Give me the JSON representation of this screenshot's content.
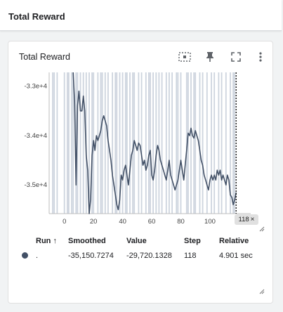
{
  "section": {
    "title": "Total Reward"
  },
  "card": {
    "title": "Total Reward",
    "toolbar": {
      "icons": [
        "fit-domain-icon",
        "pin-icon",
        "fullscreen-icon",
        "more-vert-icon"
      ]
    }
  },
  "chart_data": {
    "type": "line",
    "title": "",
    "xlabel": "",
    "ylabel": "",
    "xlim": [
      -10,
      128
    ],
    "ylim": [
      -35580,
      -32720
    ],
    "x_ticks": [
      "0",
      "20",
      "40",
      "60",
      "80",
      "100"
    ],
    "y_ticks": [
      "-3.3e+4",
      "-3.4e+4",
      "-3.5e+4"
    ],
    "x_tick_values": [
      0,
      20,
      40,
      60,
      80,
      100
    ],
    "y_tick_values": [
      -33000,
      -34000,
      -35000
    ],
    "series": [
      {
        "color": "#425066",
        "points": [
          [
            6,
            -32720
          ],
          [
            7,
            -33300
          ],
          [
            8,
            -35000
          ],
          [
            9,
            -33400
          ],
          [
            10,
            -33100
          ],
          [
            11,
            -33500
          ],
          [
            12,
            -33500
          ],
          [
            13,
            -33200
          ],
          [
            14,
            -33500
          ],
          [
            15,
            -34400
          ],
          [
            16,
            -34700
          ],
          [
            17,
            -35580
          ],
          [
            18,
            -35300
          ],
          [
            19,
            -34400
          ],
          [
            20,
            -34100
          ],
          [
            21,
            -34300
          ],
          [
            22,
            -34000
          ],
          [
            23,
            -34100
          ],
          [
            24,
            -34000
          ],
          [
            25,
            -33900
          ],
          [
            26,
            -33700
          ],
          [
            27,
            -33600
          ],
          [
            28,
            -33700
          ],
          [
            29,
            -33800
          ],
          [
            30,
            -34100
          ],
          [
            31,
            -34300
          ],
          [
            32,
            -34500
          ],
          [
            33,
            -34800
          ],
          [
            34,
            -35000
          ],
          [
            35,
            -35200
          ],
          [
            36,
            -35400
          ],
          [
            37,
            -35500
          ],
          [
            38,
            -35300
          ],
          [
            39,
            -34800
          ],
          [
            40,
            -34900
          ],
          [
            41,
            -34700
          ],
          [
            42,
            -34600
          ],
          [
            43,
            -34800
          ],
          [
            44,
            -35000
          ],
          [
            45,
            -34700
          ],
          [
            46,
            -34400
          ],
          [
            47,
            -34300
          ],
          [
            48,
            -34100
          ],
          [
            49,
            -34200
          ],
          [
            50,
            -34300
          ],
          [
            51,
            -34150
          ],
          [
            52,
            -34200
          ],
          [
            53,
            -34400
          ],
          [
            54,
            -34600
          ],
          [
            55,
            -34500
          ],
          [
            56,
            -34700
          ],
          [
            57,
            -34600
          ],
          [
            58,
            -34400
          ],
          [
            59,
            -34300
          ],
          [
            60,
            -34800
          ],
          [
            61,
            -34900
          ],
          [
            62,
            -34700
          ],
          [
            63,
            -34400
          ],
          [
            64,
            -34200
          ],
          [
            65,
            -34300
          ],
          [
            66,
            -34500
          ],
          [
            67,
            -34600
          ],
          [
            68,
            -34700
          ],
          [
            69,
            -34800
          ],
          [
            70,
            -34900
          ],
          [
            71,
            -34700
          ],
          [
            72,
            -34500
          ],
          [
            73,
            -34800
          ],
          [
            74,
            -34900
          ],
          [
            75,
            -35000
          ],
          [
            76,
            -35100
          ],
          [
            77,
            -35000
          ],
          [
            78,
            -34900
          ],
          [
            79,
            -34700
          ],
          [
            80,
            -34500
          ],
          [
            81,
            -34700
          ],
          [
            82,
            -34900
          ],
          [
            83,
            -34600
          ],
          [
            84,
            -34300
          ],
          [
            85,
            -33950
          ],
          [
            86,
            -34000
          ],
          [
            87,
            -33850
          ],
          [
            88,
            -34000
          ],
          [
            89,
            -34050
          ],
          [
            90,
            -33900
          ],
          [
            91,
            -34000
          ],
          [
            92,
            -34100
          ],
          [
            93,
            -34300
          ],
          [
            94,
            -34500
          ],
          [
            95,
            -34600
          ],
          [
            96,
            -34800
          ],
          [
            97,
            -34900
          ],
          [
            98,
            -35000
          ],
          [
            99,
            -35100
          ],
          [
            100,
            -34900
          ],
          [
            101,
            -34800
          ],
          [
            102,
            -34900
          ],
          [
            103,
            -34800
          ],
          [
            104,
            -34900
          ],
          [
            105,
            -34700
          ],
          [
            106,
            -34800
          ],
          [
            107,
            -34700
          ],
          [
            108,
            -34900
          ],
          [
            109,
            -34800
          ],
          [
            110,
            -34900
          ],
          [
            111,
            -35000
          ],
          [
            112,
            -34800
          ],
          [
            113,
            -34900
          ],
          [
            114,
            -35200
          ],
          [
            115,
            -35250
          ],
          [
            116,
            -35400
          ],
          [
            117,
            -35300
          ],
          [
            118,
            -35150
          ]
        ]
      }
    ],
    "shaded_steps": [
      -8,
      -7,
      -5,
      0,
      2,
      3,
      5,
      6,
      8,
      9,
      11,
      13,
      15,
      17,
      19,
      20,
      23,
      25,
      26,
      28,
      30,
      33,
      35,
      36,
      38,
      40,
      42,
      43,
      45,
      47,
      48,
      51,
      53,
      56,
      58,
      59,
      61,
      63,
      65,
      67,
      70,
      72,
      74,
      77,
      78,
      80,
      84,
      85,
      87,
      89,
      90,
      93,
      95,
      98,
      101,
      103,
      106,
      108,
      111,
      114,
      116,
      117
    ],
    "grid": false,
    "legend": "none",
    "cursor_step": 118
  },
  "step_badge": {
    "label": "118",
    "close": "×"
  },
  "table": {
    "headers": {
      "run": "Run",
      "sort_arrow": "↑",
      "smoothed": "Smoothed",
      "value": "Value",
      "step": "Step",
      "relative": "Relative"
    },
    "rows": [
      {
        "run": ".",
        "smoothed": "-35,150.7274",
        "value": "-29,720.1328",
        "step": "118",
        "relative": "4.901 sec",
        "color": "#425066"
      }
    ]
  }
}
